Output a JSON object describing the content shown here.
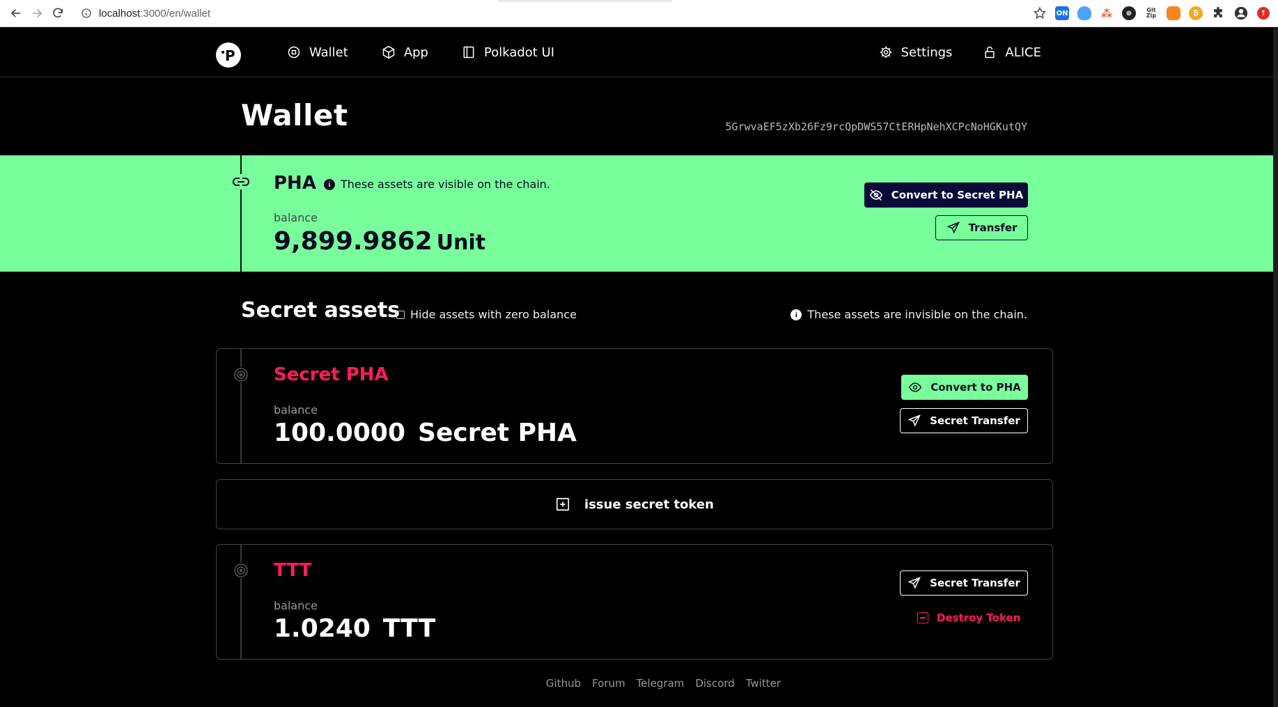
{
  "browser": {
    "url_host": "localhost",
    "url_path": ":3000/en/wallet",
    "extensions": [
      "on-badge-icon",
      "shield-ext-icon",
      "network-ext-icon",
      "circle-ext-icon",
      "gitzip-ext-icon",
      "fox-ext-icon",
      "coin-ext-icon",
      "puzzle-icon",
      "profile-icon",
      "update-icon"
    ],
    "ext_label_on": "ON",
    "ext_label_gitzip": "Git\nZip"
  },
  "nav": {
    "logo_letter": "P",
    "links": [
      {
        "label": "Wallet",
        "icon": "wallet-icon"
      },
      {
        "label": "App",
        "icon": "cube-icon"
      },
      {
        "label": "Polkadot UI",
        "icon": "sidebar-icon"
      }
    ],
    "settings_label": "Settings",
    "account_label": "ALICE"
  },
  "page": {
    "title": "Wallet",
    "address": "5GrwvaEF5zXb26Fz9rcQpDWS57CtERHpNehXCPcNoHGKutQY"
  },
  "pha": {
    "symbol": "PHA",
    "note": "These assets are visible on the chain.",
    "balance_label": "balance",
    "amount": "9,899.9862",
    "unit": "Unit",
    "convert_label": "Convert to Secret PHA",
    "transfer_label": "Transfer"
  },
  "secret": {
    "title": "Secret assets",
    "hide_zero_label": "Hide assets with zero balance",
    "note": "These assets are invisible on the chain.",
    "tokens": [
      {
        "name": "Secret PHA",
        "balance_label": "balance",
        "amount": "100.0000",
        "unit": "Secret PHA",
        "convert_label": "Convert to PHA",
        "transfer_label": "Secret Transfer"
      },
      {
        "name": "TTT",
        "balance_label": "balance",
        "amount": "1.0240",
        "unit": "TTT",
        "transfer_label": "Secret Transfer",
        "destroy_label": "Destroy Token"
      }
    ],
    "issue_label": "issue secret token"
  },
  "footer": {
    "links": [
      "Github",
      "Forum",
      "Telegram",
      "Discord",
      "Twitter"
    ]
  },
  "colors": {
    "accent_green": "#78ff9b",
    "accent_red": "#ff1c5b",
    "navy": "#0b0b3a"
  }
}
